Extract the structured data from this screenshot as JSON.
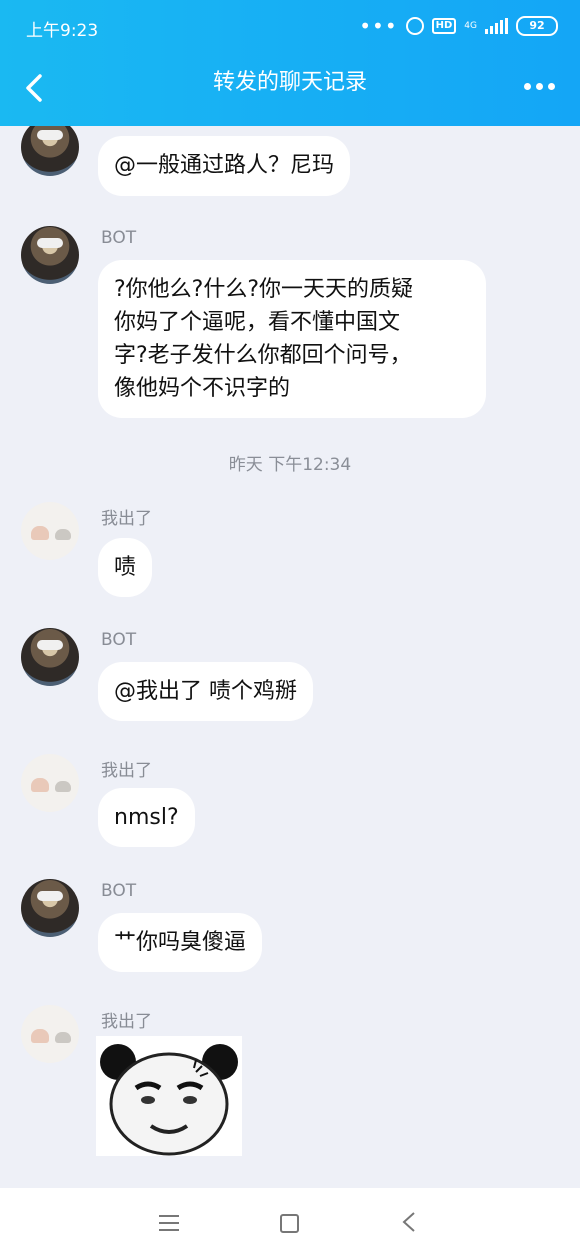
{
  "status_bar": {
    "time": "上午9:23",
    "network": "4G",
    "hd": "HD",
    "battery": "92"
  },
  "header": {
    "title": "转发的聊天记录"
  },
  "messages": [
    {
      "sender": "",
      "text": "@一般通过路人？尼玛"
    },
    {
      "sender": "BOT",
      "text": "?你他么?什么?你一天天的质疑\n你妈了个逼呢，看不懂中国文\n字?老子发什么你都回个问号，\n像他妈个不识字的"
    },
    {
      "sender": "我出了",
      "text": "啧"
    },
    {
      "sender": "BOT",
      "text": "@我出了 啧个鸡掰"
    },
    {
      "sender": "我出了",
      "text": "nmsl?"
    },
    {
      "sender": "BOT",
      "text": "艹你吗臭傻逼"
    },
    {
      "sender": "我出了",
      "image": "panda-meme-sticker"
    }
  ],
  "timestamp": "昨天 下午12:34",
  "icons": {
    "back": "chevron-left-icon",
    "more": "more-dots-icon",
    "nav_menu": "menu-icon",
    "nav_home": "home-square-icon",
    "nav_back": "back-triangle-icon"
  },
  "colors": {
    "header": "#17aff4",
    "background": "#eef0f7",
    "bubble": "#ffffff"
  }
}
